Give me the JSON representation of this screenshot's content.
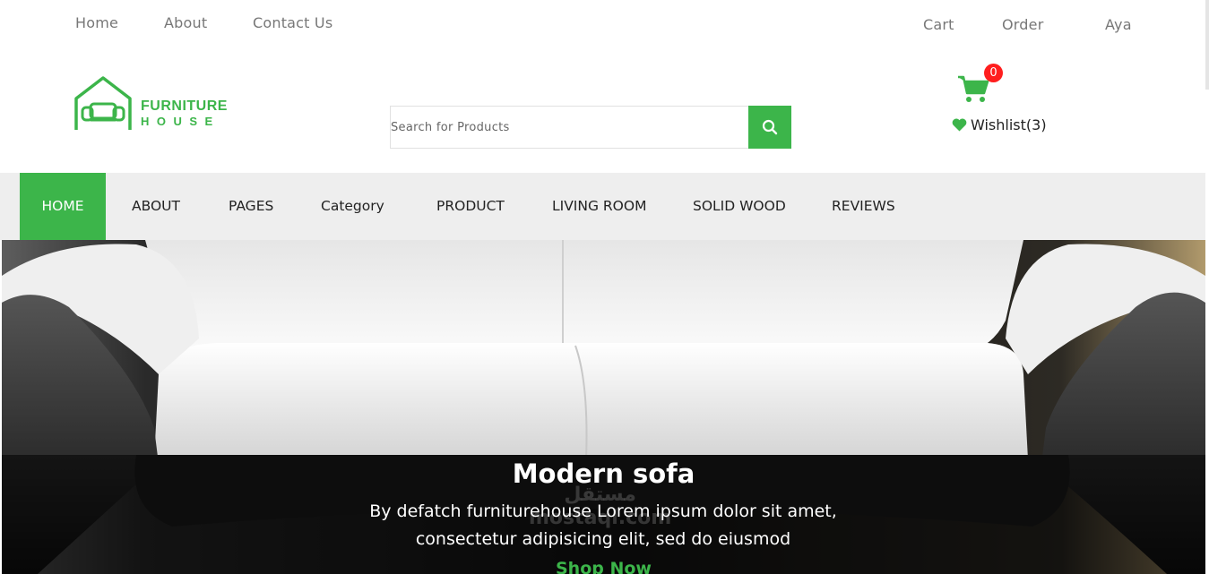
{
  "topbar": {
    "links_left": [
      "Home",
      "About",
      "Contact Us"
    ],
    "links_right": [
      "Cart",
      "Order",
      "Aya"
    ]
  },
  "logo": {
    "line1": "FURNITURE",
    "line2": "HOUSE",
    "color": "#3cb54a"
  },
  "search": {
    "placeholder": "Search for Products",
    "button_icon": "search-icon"
  },
  "cart": {
    "icon": "cart-icon",
    "count": "0"
  },
  "wishlist": {
    "icon": "heart-icon",
    "label": "Wishlist(3)"
  },
  "nav": {
    "items": [
      "HOME",
      "ABOUT",
      "PAGES",
      "Category",
      "PRODUCT",
      "LIVING ROOM",
      "SOLID WOOD",
      "REVIEWS"
    ],
    "active_index": 0
  },
  "hero": {
    "title": "Modern sofa",
    "text": "By defatch furniturehouse Lorem ipsum dolor sit amet, consectetur adipisicing elit, sed do eiusmod",
    "link": "Shop Now"
  },
  "watermark": {
    "line1": "مستقل",
    "line2": "mostaql.com"
  },
  "colors": {
    "accent": "#3cb54a",
    "badge": "#ff1e1e",
    "nav_bg": "#eeeeee"
  }
}
